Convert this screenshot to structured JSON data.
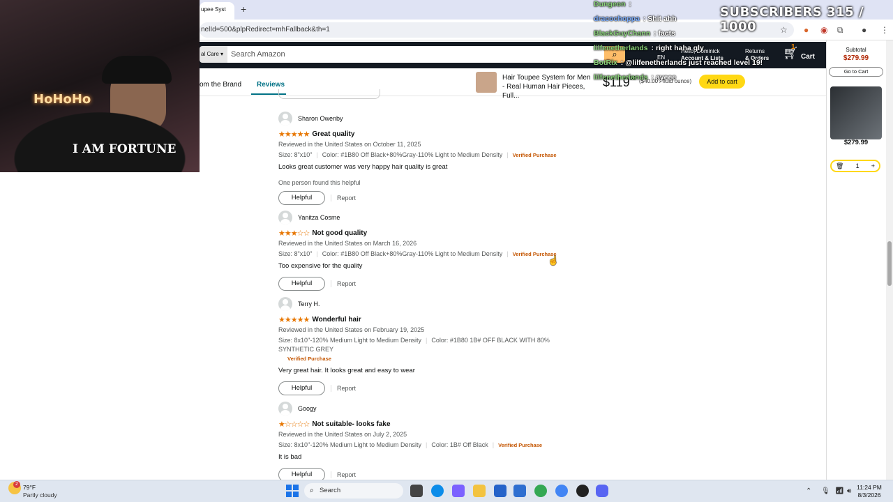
{
  "browser": {
    "tab_title": "upee Syst",
    "new_tab": "+",
    "url": "nelId=500&plpRedirect=mhFallback&th=1"
  },
  "amazon_header": {
    "category": "al Care",
    "search_placeholder": "Search Amazon",
    "greeting": "Hello, Dominick",
    "account": "Account & Lists",
    "returns": "Returns",
    "orders": "& Orders",
    "lang": "EN",
    "cart_label": "Cart",
    "cart_count": "1"
  },
  "subnav": {
    "brand_tab": "om the Brand",
    "reviews_tab": "Reviews",
    "product_title": "Hair Toupee System for Men - Real Human Hair Pieces, Full...",
    "price_dollars": "119",
    "price_cents": "99",
    "unit_price": "($40.00 / fluid ounce)",
    "add_to_cart": "Add to cart"
  },
  "reviews": [
    {
      "name": "Sharon Owenby",
      "stars": "★★★★★",
      "rating": 5,
      "title": "Great quality",
      "date": "Reviewed in the United States on October 11, 2025",
      "size": "Size: 8\"x10\"",
      "color": "Color: #1B80 Off Black+80%Gray-110% Light to Medium Density",
      "verified": "Verified Purchase",
      "body": "Looks great customer was very happy hair quality is great",
      "found_helpful": "One person found this helpful",
      "helpful": "Helpful",
      "report": "Report"
    },
    {
      "name": "Yanitza Cosme",
      "stars": "★★★☆☆",
      "rating": 3,
      "title": "Not good quality",
      "date": "Reviewed in the United States on March 16, 2026",
      "size": "Size: 8\"x10\"",
      "color": "Color: #1B80 Off Black+80%Gray-110% Light to Medium Density",
      "verified": "Verified Purchase",
      "body": "Too expensive for the quality",
      "helpful": "Helpful",
      "report": "Report"
    },
    {
      "name": "Terry H.",
      "stars": "★★★★★",
      "rating": 5,
      "title": "Wonderful hair",
      "date": "Reviewed in the United States on February 19, 2025",
      "size": "Size: 8x10''-120% Medium Light to Medium Density",
      "color": "Color: #1B80 1B# OFF BLACK WITH 80% SYNTHETIC GREY",
      "verified": "Verified Purchase",
      "body": "Very great hair. It looks great and easy to wear",
      "helpful": "Helpful",
      "report": "Report"
    },
    {
      "name": "Googy",
      "stars": "★☆☆☆☆",
      "rating": 1,
      "title": "Not suitable- looks fake",
      "date": "Reviewed in the United States on July 2, 2025",
      "size": "Size: 8x10''-120% Medium Light to Medium Density",
      "color": "Color: 1B# Off Black",
      "verified": "Verified Purchase",
      "body": "It is bad",
      "helpful": "Helpful",
      "report": "Report"
    }
  ],
  "cart_sidebar": {
    "subtotal_label": "Subtotal",
    "subtotal": "$279.99",
    "go_to_cart": "Go to Cart",
    "item_price": "$279.99",
    "qty": "1"
  },
  "overlay": {
    "subscribers": "SUBSCRIBERS 315 / 1000",
    "webcam_neon": "HoHoHo",
    "webcam_shirt": "I AM FORTUNE",
    "chat": [
      {
        "user": "Dungeon",
        "sep": " : ",
        "msg": "",
        "color": "#8ad37a"
      },
      {
        "user": "dracochoppa",
        "sep": " : ",
        "msg": "Shit ahh",
        "color": "#7fb0ff"
      },
      {
        "user": "BlackGuyChann",
        "sep": " : ",
        "msg": "facts",
        "color": "#8ad37a"
      },
      {
        "user": "lilfenetherlands",
        "sep": " : ",
        "msg": "right haha gly",
        "color": "#8ad37a"
      },
      {
        "user": "BotRix",
        "sep": " : ",
        "msg": "@lilfenetherlands just reached level 19!",
        "color": "#8ad37a"
      },
      {
        "user": "lilfenetherlands",
        "sep": " : ",
        "msg": "ayeee",
        "color": "#8ad37a"
      }
    ]
  },
  "taskbar": {
    "weather_temp": "79°F",
    "weather_desc": "Partly cloudy",
    "weather_badge": "2",
    "search": "Search",
    "time": "11:24 PM",
    "date": "8/3/2026"
  }
}
